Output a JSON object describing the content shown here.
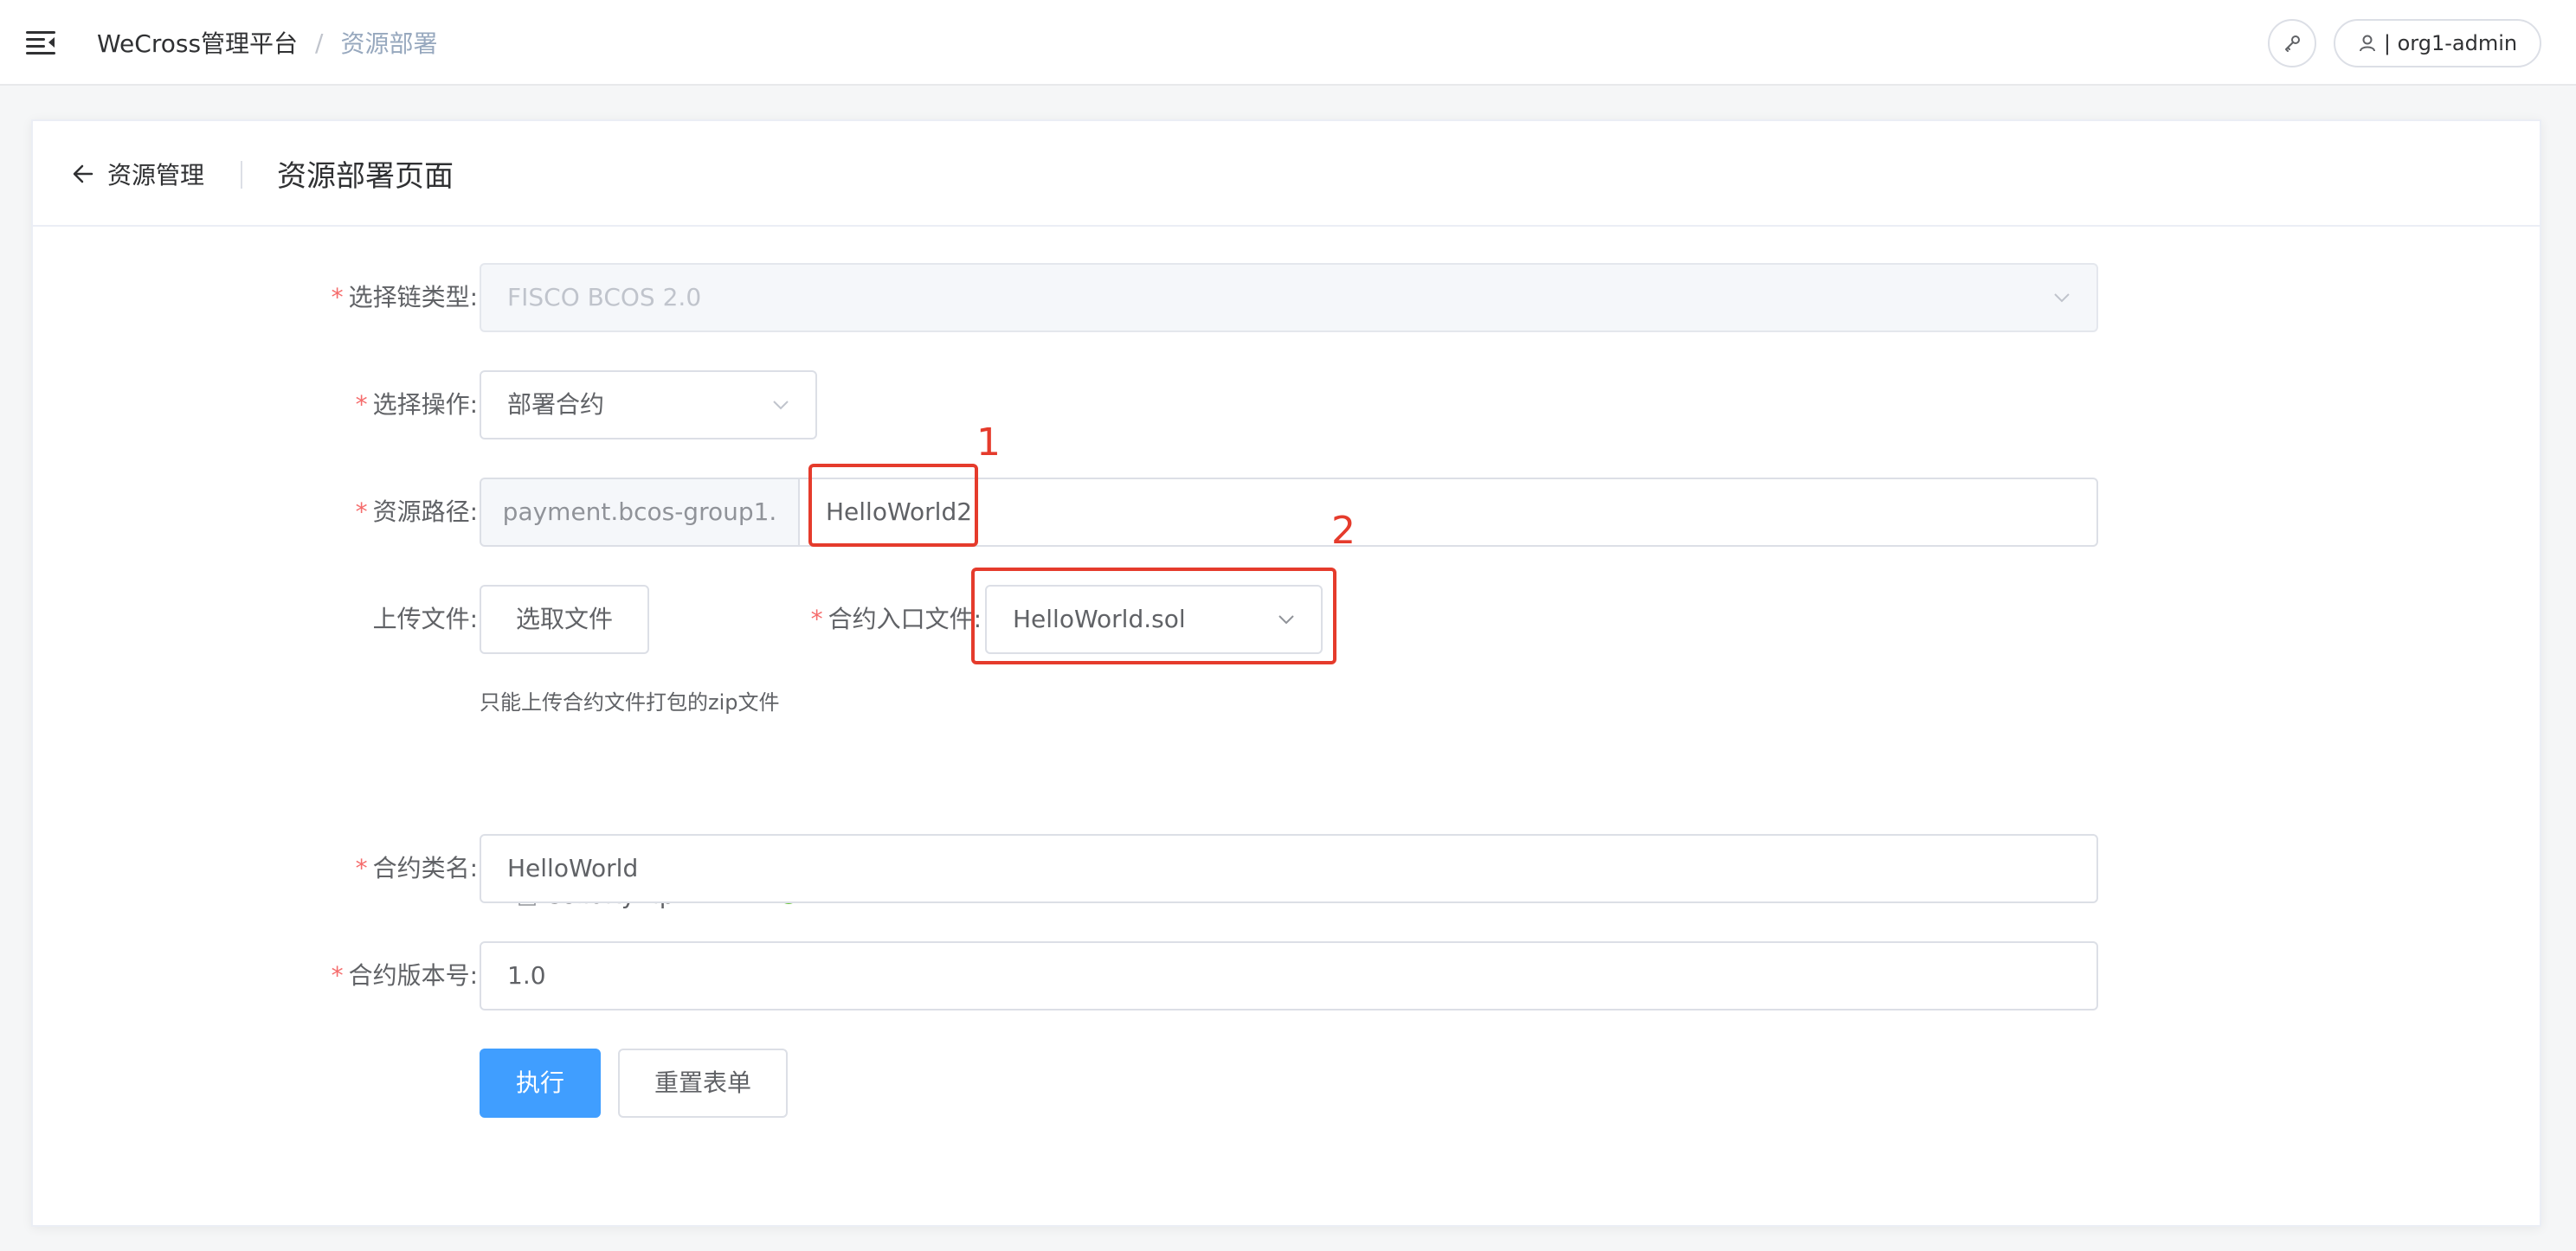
{
  "topbar": {
    "breadcrumb_home": "WeCross管理平台",
    "breadcrumb_sep": "/",
    "breadcrumb_current": "资源部署",
    "user_label": "| org1-admin"
  },
  "header": {
    "back_label": "资源管理",
    "title": "资源部署页面"
  },
  "form": {
    "required_mark": "*",
    "chain_type": {
      "label": "选择链类型:",
      "value": "FISCO BCOS 2.0"
    },
    "operation": {
      "label": "选择操作:",
      "value": "部署合约"
    },
    "resource_path": {
      "label": "资源路径:",
      "prefix": "payment.bcos-group1.",
      "value": "HelloWorld2"
    },
    "upload": {
      "label": "上传文件:",
      "button": "选取文件",
      "hint": "只能上传合约文件打包的zip文件",
      "file_name": "solidity.zip"
    },
    "entry_file": {
      "label": "合约入口文件:",
      "value": "HelloWorld.sol"
    },
    "class_name": {
      "label": "合约类名:",
      "value": "HelloWorld"
    },
    "version": {
      "label": "合约版本号:",
      "value": "1.0"
    },
    "submit_label": "执行",
    "reset_label": "重置表单"
  },
  "annotations": [
    {
      "number": "1"
    },
    {
      "number": "2"
    }
  ],
  "colors": {
    "primary": "#409eff",
    "required": "#f56c6c",
    "annotation": "#e53b2c",
    "success": "#67c23a"
  },
  "icons": [
    "menu-toggle-icon",
    "key-icon",
    "user-icon",
    "arrow-left-icon",
    "chevron-down-icon",
    "document-icon",
    "check-circle-icon"
  ]
}
